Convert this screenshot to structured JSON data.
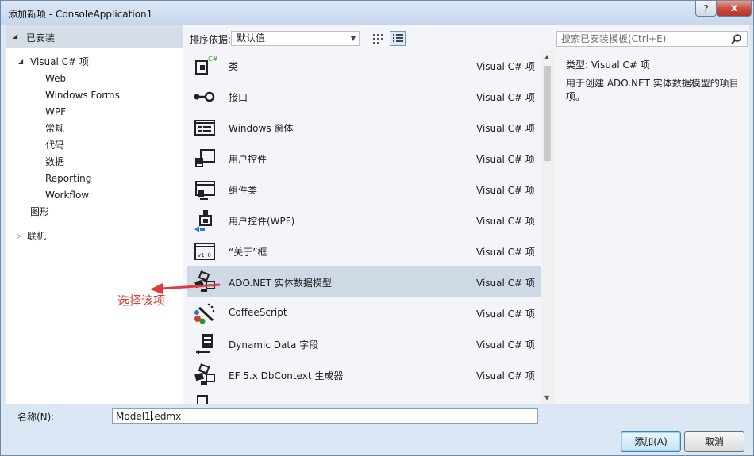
{
  "window": {
    "title": "添加新项 - ConsoleApplication1",
    "help": "?",
    "close": "x"
  },
  "tree": {
    "header": "已安装",
    "items": [
      {
        "label": "Visual C# 项",
        "toggle": "◢"
      },
      {
        "label": "Web"
      },
      {
        "label": "Windows Forms"
      },
      {
        "label": "WPF"
      },
      {
        "label": "常规"
      },
      {
        "label": "代码"
      },
      {
        "label": "数据"
      },
      {
        "label": "Reporting"
      },
      {
        "label": "Workflow"
      },
      {
        "label": "图形"
      },
      {
        "label": "联机",
        "toggle": "▷"
      }
    ]
  },
  "toolbar": {
    "sort_label": "排序依据:",
    "sort_value": "默认值",
    "search_placeholder": "搜索已安装模板(Ctrl+E)"
  },
  "list": {
    "items": [
      {
        "name": "类",
        "type": "Visual C# 项",
        "icon": "class-icon"
      },
      {
        "name": "接口",
        "type": "Visual C# 项",
        "icon": "interface-icon"
      },
      {
        "name": "Windows 窗体",
        "type": "Visual C# 项",
        "icon": "windows-form-icon"
      },
      {
        "name": "用户控件",
        "type": "Visual C# 项",
        "icon": "user-control-icon"
      },
      {
        "name": "组件类",
        "type": "Visual C# 项",
        "icon": "component-class-icon"
      },
      {
        "name": "用户控件(WPF)",
        "type": "Visual C# 项",
        "icon": "wpf-user-control-icon"
      },
      {
        "name": "“关于”框",
        "type": "Visual C# 项",
        "icon": "about-box-icon"
      },
      {
        "name": "ADO.NET 实体数据模型",
        "type": "Visual C# 项",
        "icon": "entity-model-icon",
        "selected": true
      },
      {
        "name": "CoffeeScript",
        "type": "Visual C# 项",
        "icon": "coffeescript-icon"
      },
      {
        "name": "Dynamic Data 字段",
        "type": "Visual C# 项",
        "icon": "dynamic-data-icon"
      },
      {
        "name": "EF 5.x DbContext 生成器",
        "type": "Visual C# 项",
        "icon": "dbcontext-generator-icon"
      }
    ]
  },
  "detail": {
    "type_line": "类型:  Visual C# 项",
    "description": "用于创建 ADO.NET 实体数据模型的项目项。"
  },
  "bottom": {
    "name_label": "名称(N):",
    "name_value_a": "Model1",
    "name_value_b": ".edmx",
    "ok": "添加(A)",
    "cancel": "取消"
  },
  "annotation": {
    "text": "选择该项",
    "color": "#e03a3a"
  }
}
